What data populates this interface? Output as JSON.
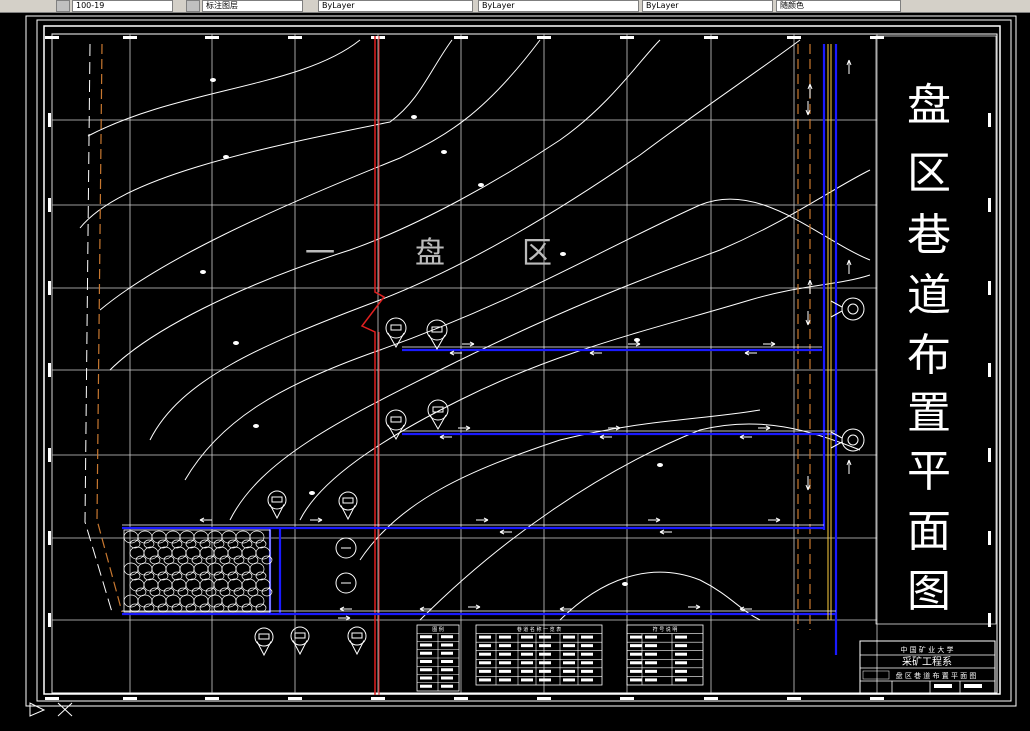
{
  "toolbar": {
    "layer_value": "ByLayer",
    "linetype_value": "ByLayer",
    "lineweight_value": "ByLayer",
    "plotstyle_value": "随颜色",
    "view_value": "100-19",
    "layer_state_value": "标注图层"
  },
  "drawing": {
    "area_label_chars": [
      "一",
      "盘",
      "区"
    ],
    "title_chars": [
      "盘",
      "区",
      "巷",
      "道",
      "布",
      "置",
      "平",
      "面",
      "图"
    ]
  },
  "title_block": {
    "school": "中 国 矿 业 大 学",
    "department": "采矿工程系",
    "drawing_name": "盘 区 巷 道 布 置 平 面 图"
  },
  "legend_tables": {
    "table1_title": "图 例",
    "table2_title": "巷 道 名 称 一 览 表",
    "table3_title": "符 号 说 明"
  },
  "colors": {
    "background": "#000000",
    "frame": "#ffffff",
    "roadway": "#1010ff",
    "fault": "#e02020",
    "boundary": "#c87830",
    "contour": "#ffffff"
  },
  "icons": {
    "crosshair": "ucs-crosshair-icon",
    "ucs": "ucs-triangle-icon"
  }
}
